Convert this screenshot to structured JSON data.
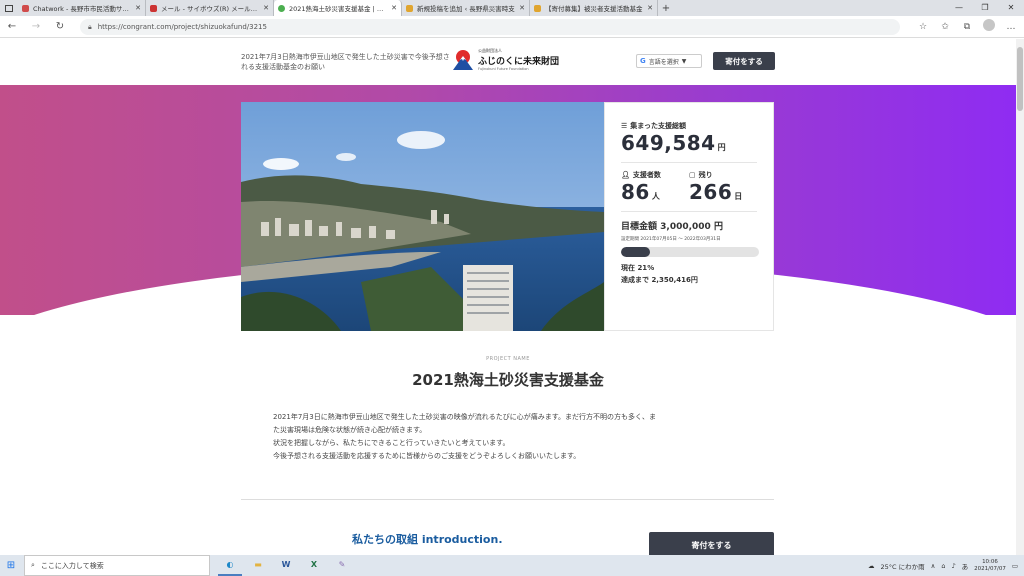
{
  "browser": {
    "tabs": [
      {
        "title": "Chatwork - 長野市市民活動サポー",
        "favicon_color": "#d04b4b",
        "active": false
      },
      {
        "title": "メール - サイボウズ(R) メールワイズ(R)",
        "favicon_color": "#cc3333",
        "active": false
      },
      {
        "title": "2021熱海土砂災害支援基金 | クラ",
        "favicon_color": "#4caf50",
        "active": true
      },
      {
        "title": "新規投稿を追加 ‹ 長野県災害時支",
        "favicon_color": "#e0a52f",
        "active": false
      },
      {
        "title": "【寄付募集】被災者支援活動基金",
        "favicon_color": "#e0a52f",
        "active": false
      }
    ],
    "url": "https://congrant.com/project/shizuokafund/3215"
  },
  "header": {
    "tagline": "2021年7月3日熱海市伊豆山地区で発生した土砂災害で今後予想される支援活動基金のお願い",
    "org_small": "公益財団法人",
    "org_name": "ふじのくに未来財団",
    "org_en": "Fujinokuni Future Foundation",
    "lang_label": "言語を選択",
    "donate_label": "寄付をする"
  },
  "stats": {
    "total_label": "集まった支援総額",
    "total_value": "649,584",
    "total_unit": "円",
    "supporters_label": "支援者数",
    "supporters_value": "86",
    "supporters_unit": "人",
    "remaining_label": "残り",
    "remaining_value": "266",
    "remaining_unit": "日",
    "goal_label": "目標金額 3,000,000 円",
    "period": "設定期間 2021年07月05日 〜 2022年03月31日",
    "progress_fraction": 0.21,
    "now_prefix": "現在 ",
    "now_value": "21",
    "now_unit": "%",
    "remain_prefix": "達成まで ",
    "remain_value": "2,350,416",
    "remain_unit": "円"
  },
  "project": {
    "label": "PROJECT NAME",
    "title": "2021熱海土砂災害支援基金",
    "description": [
      "2021年7月3日に熱海市伊豆山地区で発生した土砂災害の映像が流れるたびに心が痛みます。まだ行方不明の方も多く、ま",
      "た災害現場は危険な状態が続き心配が続きます。",
      "状況を把握しながら、私たちにできること行っていきたいと考えています。",
      "今後予想される支援活動を応援するために皆様からのご支援をどうぞよろしくお願いいたします。"
    ],
    "intro_heading": "私たちの取組 introduction.",
    "donate_label": "寄付をする"
  },
  "taskbar": {
    "search_placeholder": "ここに入力して検索",
    "weather": "25°C にわか雨",
    "ime": "あ",
    "time": "10:06",
    "date": "2021/07/07"
  }
}
